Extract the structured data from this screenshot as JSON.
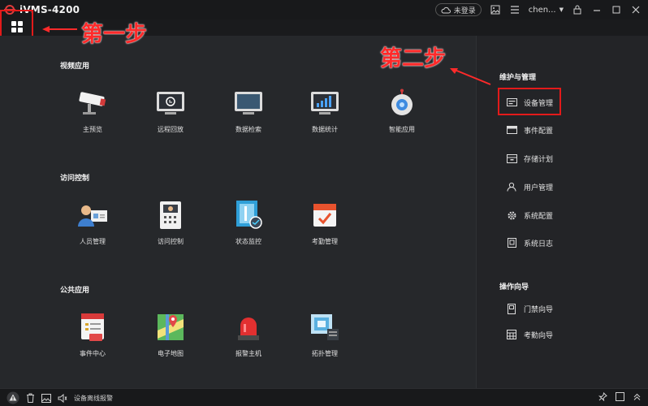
{
  "titlebar": {
    "app_title": "iVMS-4200",
    "login_label": "未登录",
    "user_name": "chen..."
  },
  "annotations": {
    "step1": "第一步",
    "step2": "第二步"
  },
  "sections": {
    "video": {
      "title": "视频应用",
      "tiles": [
        "主预览",
        "远程回放",
        "数据检索",
        "数据统计",
        "智能应用"
      ]
    },
    "access": {
      "title": "访问控制",
      "tiles": [
        "人员管理",
        "访问控制",
        "状态监控",
        "考勤管理"
      ]
    },
    "public": {
      "title": "公共应用",
      "tiles": [
        "事件中心",
        "电子地图",
        "报警主机",
        "拓扑管理"
      ]
    }
  },
  "sidebar": {
    "maint_title": "维护与管理",
    "maint_items": [
      "设备管理",
      "事件配置",
      "存储计划",
      "用户管理",
      "系统配置",
      "系统日志"
    ],
    "wizard_title": "操作向导",
    "wizard_items": [
      "门禁向导",
      "考勤向导"
    ]
  },
  "statusbar": {
    "alarm_text": "设备离线报警"
  },
  "colors": {
    "accent_red": "#e31a1a",
    "panel_bg": "#26282b",
    "sidebar_bg": "#232427"
  }
}
